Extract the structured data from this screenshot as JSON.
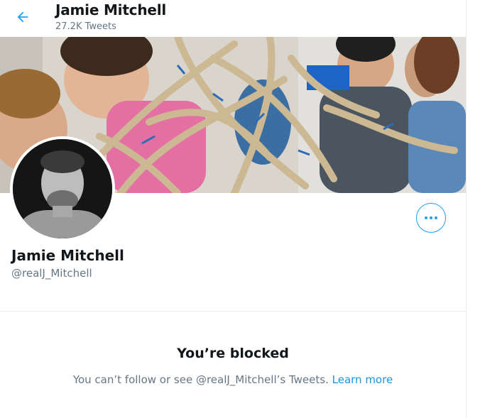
{
  "header": {
    "name": "Jamie Mitchell",
    "tweet_count": "27.2K Tweets",
    "back_icon": "arrow-left-icon"
  },
  "banner": {
    "icon": "banner-image"
  },
  "profile": {
    "name": "Jamie Mitchell",
    "handle": "@realJ_Mitchell",
    "more_icon": "more-horizontal-icon"
  },
  "blocked": {
    "title": "You’re blocked",
    "message": "You can’t follow or see @realJ_Mitchell’s Tweets.",
    "link": "Learn more"
  },
  "colors": {
    "accent": "#1da1f2",
    "link": "#1b95e0",
    "text": "#14171a",
    "secondary": "#657786"
  }
}
